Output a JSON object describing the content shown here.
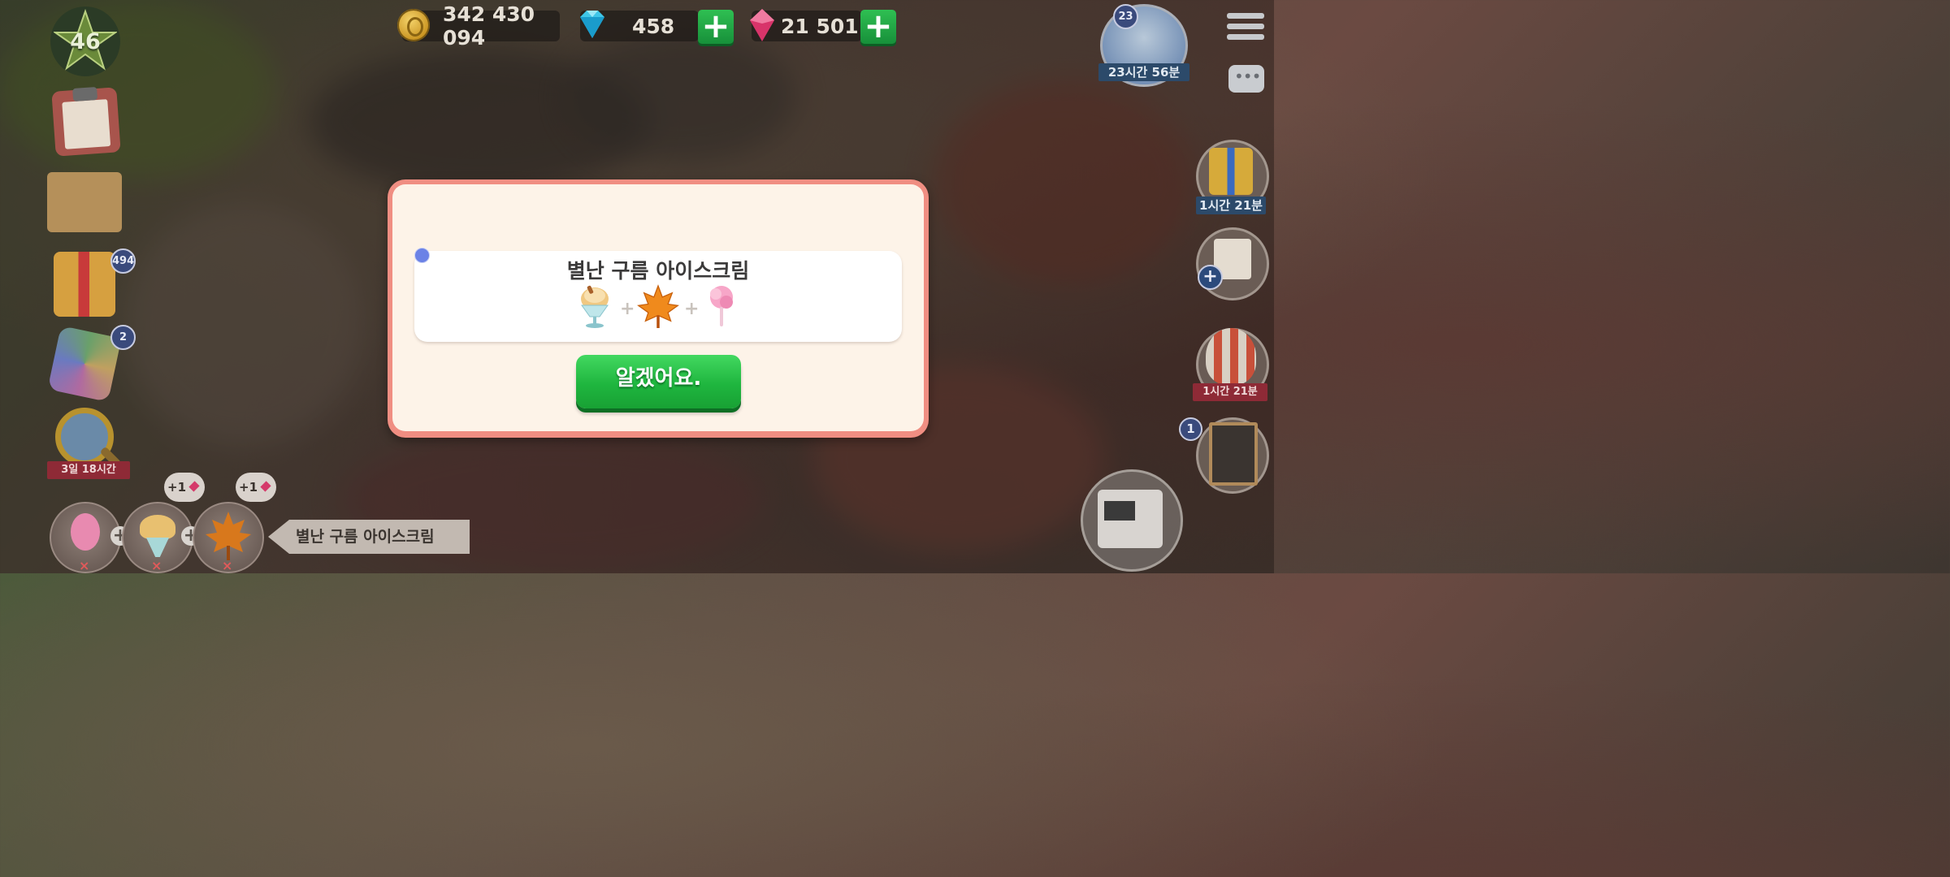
{
  "hud": {
    "level": "46",
    "coins": "342 430 094",
    "diamonds": "458",
    "gems": "21 501",
    "event_badge": "23",
    "event_timer": "23시간 56분"
  },
  "left_panel": {
    "gift_badge": "494",
    "cube_badge": "2",
    "search_timer": "3일 18시간"
  },
  "right_panel": {
    "gift_timer": "1시간 21분",
    "balloon_timer": "1시간 21분",
    "board_badge": "1"
  },
  "bottom_bar": {
    "bonus_1": "+1",
    "bonus_2": "+1",
    "recipe_label": "별난 구름 아이스크림"
  },
  "dialog": {
    "title": "별난 구름 아이스크림",
    "ingredients": [
      "ice-cream-cup-icon",
      "maple-leaf-icon",
      "cotton-candy-icon"
    ],
    "ok_label": "알겠어요."
  },
  "colors": {
    "dialog_border": "#f08e82",
    "dialog_bg": "#fdf3e8",
    "ok_button": "#1fb63f",
    "plus_button": "#2fbf52"
  }
}
